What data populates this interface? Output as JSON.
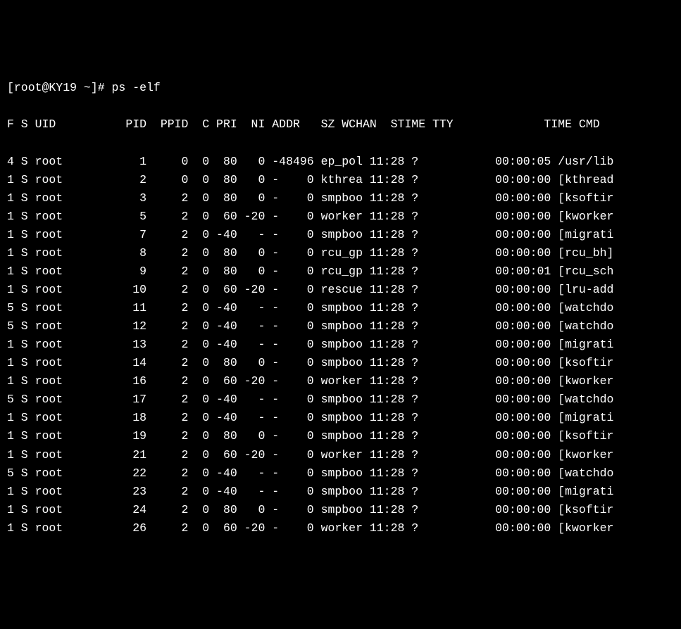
{
  "prompt": "[root@KY19 ~]# ps -elf",
  "header": {
    "F": "F",
    "S": "S",
    "UID": "UID",
    "PID": "PID",
    "PPID": "PPID",
    "C": "C",
    "PRI": "PRI",
    "NI": "NI",
    "ADDR": "ADDR",
    "SZ": "SZ",
    "WCHAN": "WCHAN",
    "STIME": "STIME",
    "TTY": "TTY",
    "TIME": "TIME",
    "CMD": "CMD"
  },
  "rows": [
    {
      "F": "4",
      "S": "S",
      "UID": "root",
      "PID": "1",
      "PPID": "0",
      "C": "0",
      "PRI": "80",
      "NI": "0",
      "ADDR": "-",
      "SZ": "48496",
      "WCHAN": "ep_pol",
      "STIME": "11:28",
      "TTY": "?",
      "TIME": "00:00:05",
      "CMD": "/usr/lib"
    },
    {
      "F": "1",
      "S": "S",
      "UID": "root",
      "PID": "2",
      "PPID": "0",
      "C": "0",
      "PRI": "80",
      "NI": "0",
      "ADDR": "-",
      "SZ": "0",
      "WCHAN": "kthrea",
      "STIME": "11:28",
      "TTY": "?",
      "TIME": "00:00:00",
      "CMD": "[kthread"
    },
    {
      "F": "1",
      "S": "S",
      "UID": "root",
      "PID": "3",
      "PPID": "2",
      "C": "0",
      "PRI": "80",
      "NI": "0",
      "ADDR": "-",
      "SZ": "0",
      "WCHAN": "smpboo",
      "STIME": "11:28",
      "TTY": "?",
      "TIME": "00:00:00",
      "CMD": "[ksoftir"
    },
    {
      "F": "1",
      "S": "S",
      "UID": "root",
      "PID": "5",
      "PPID": "2",
      "C": "0",
      "PRI": "60",
      "NI": "-20",
      "ADDR": "-",
      "SZ": "0",
      "WCHAN": "worker",
      "STIME": "11:28",
      "TTY": "?",
      "TIME": "00:00:00",
      "CMD": "[kworker"
    },
    {
      "F": "1",
      "S": "S",
      "UID": "root",
      "PID": "7",
      "PPID": "2",
      "C": "0",
      "PRI": "-40",
      "NI": "-",
      "ADDR": "-",
      "SZ": "0",
      "WCHAN": "smpboo",
      "STIME": "11:28",
      "TTY": "?",
      "TIME": "00:00:00",
      "CMD": "[migrati"
    },
    {
      "F": "1",
      "S": "S",
      "UID": "root",
      "PID": "8",
      "PPID": "2",
      "C": "0",
      "PRI": "80",
      "NI": "0",
      "ADDR": "-",
      "SZ": "0",
      "WCHAN": "rcu_gp",
      "STIME": "11:28",
      "TTY": "?",
      "TIME": "00:00:00",
      "CMD": "[rcu_bh]"
    },
    {
      "F": "1",
      "S": "S",
      "UID": "root",
      "PID": "9",
      "PPID": "2",
      "C": "0",
      "PRI": "80",
      "NI": "0",
      "ADDR": "-",
      "SZ": "0",
      "WCHAN": "rcu_gp",
      "STIME": "11:28",
      "TTY": "?",
      "TIME": "00:00:01",
      "CMD": "[rcu_sch"
    },
    {
      "F": "1",
      "S": "S",
      "UID": "root",
      "PID": "10",
      "PPID": "2",
      "C": "0",
      "PRI": "60",
      "NI": "-20",
      "ADDR": "-",
      "SZ": "0",
      "WCHAN": "rescue",
      "STIME": "11:28",
      "TTY": "?",
      "TIME": "00:00:00",
      "CMD": "[lru-add"
    },
    {
      "F": "5",
      "S": "S",
      "UID": "root",
      "PID": "11",
      "PPID": "2",
      "C": "0",
      "PRI": "-40",
      "NI": "-",
      "ADDR": "-",
      "SZ": "0",
      "WCHAN": "smpboo",
      "STIME": "11:28",
      "TTY": "?",
      "TIME": "00:00:00",
      "CMD": "[watchdo"
    },
    {
      "F": "5",
      "S": "S",
      "UID": "root",
      "PID": "12",
      "PPID": "2",
      "C": "0",
      "PRI": "-40",
      "NI": "-",
      "ADDR": "-",
      "SZ": "0",
      "WCHAN": "smpboo",
      "STIME": "11:28",
      "TTY": "?",
      "TIME": "00:00:00",
      "CMD": "[watchdo"
    },
    {
      "F": "1",
      "S": "S",
      "UID": "root",
      "PID": "13",
      "PPID": "2",
      "C": "0",
      "PRI": "-40",
      "NI": "-",
      "ADDR": "-",
      "SZ": "0",
      "WCHAN": "smpboo",
      "STIME": "11:28",
      "TTY": "?",
      "TIME": "00:00:00",
      "CMD": "[migrati"
    },
    {
      "F": "1",
      "S": "S",
      "UID": "root",
      "PID": "14",
      "PPID": "2",
      "C": "0",
      "PRI": "80",
      "NI": "0",
      "ADDR": "-",
      "SZ": "0",
      "WCHAN": "smpboo",
      "STIME": "11:28",
      "TTY": "?",
      "TIME": "00:00:00",
      "CMD": "[ksoftir"
    },
    {
      "F": "1",
      "S": "S",
      "UID": "root",
      "PID": "16",
      "PPID": "2",
      "C": "0",
      "PRI": "60",
      "NI": "-20",
      "ADDR": "-",
      "SZ": "0",
      "WCHAN": "worker",
      "STIME": "11:28",
      "TTY": "?",
      "TIME": "00:00:00",
      "CMD": "[kworker"
    },
    {
      "F": "5",
      "S": "S",
      "UID": "root",
      "PID": "17",
      "PPID": "2",
      "C": "0",
      "PRI": "-40",
      "NI": "-",
      "ADDR": "-",
      "SZ": "0",
      "WCHAN": "smpboo",
      "STIME": "11:28",
      "TTY": "?",
      "TIME": "00:00:00",
      "CMD": "[watchdo"
    },
    {
      "F": "1",
      "S": "S",
      "UID": "root",
      "PID": "18",
      "PPID": "2",
      "C": "0",
      "PRI": "-40",
      "NI": "-",
      "ADDR": "-",
      "SZ": "0",
      "WCHAN": "smpboo",
      "STIME": "11:28",
      "TTY": "?",
      "TIME": "00:00:00",
      "CMD": "[migrati"
    },
    {
      "F": "1",
      "S": "S",
      "UID": "root",
      "PID": "19",
      "PPID": "2",
      "C": "0",
      "PRI": "80",
      "NI": "0",
      "ADDR": "-",
      "SZ": "0",
      "WCHAN": "smpboo",
      "STIME": "11:28",
      "TTY": "?",
      "TIME": "00:00:00",
      "CMD": "[ksoftir"
    },
    {
      "F": "1",
      "S": "S",
      "UID": "root",
      "PID": "21",
      "PPID": "2",
      "C": "0",
      "PRI": "60",
      "NI": "-20",
      "ADDR": "-",
      "SZ": "0",
      "WCHAN": "worker",
      "STIME": "11:28",
      "TTY": "?",
      "TIME": "00:00:00",
      "CMD": "[kworker"
    },
    {
      "F": "5",
      "S": "S",
      "UID": "root",
      "PID": "22",
      "PPID": "2",
      "C": "0",
      "PRI": "-40",
      "NI": "-",
      "ADDR": "-",
      "SZ": "0",
      "WCHAN": "smpboo",
      "STIME": "11:28",
      "TTY": "?",
      "TIME": "00:00:00",
      "CMD": "[watchdo"
    },
    {
      "F": "1",
      "S": "S",
      "UID": "root",
      "PID": "23",
      "PPID": "2",
      "C": "0",
      "PRI": "-40",
      "NI": "-",
      "ADDR": "-",
      "SZ": "0",
      "WCHAN": "smpboo",
      "STIME": "11:28",
      "TTY": "?",
      "TIME": "00:00:00",
      "CMD": "[migrati"
    },
    {
      "F": "1",
      "S": "S",
      "UID": "root",
      "PID": "24",
      "PPID": "2",
      "C": "0",
      "PRI": "80",
      "NI": "0",
      "ADDR": "-",
      "SZ": "0",
      "WCHAN": "smpboo",
      "STIME": "11:28",
      "TTY": "?",
      "TIME": "00:00:00",
      "CMD": "[ksoftir"
    },
    {
      "F": "1",
      "S": "S",
      "UID": "root",
      "PID": "26",
      "PPID": "2",
      "C": "0",
      "PRI": "60",
      "NI": "-20",
      "ADDR": "-",
      "SZ": "0",
      "WCHAN": "worker",
      "STIME": "11:28",
      "TTY": "?",
      "TIME": "00:00:00",
      "CMD": "[kworker"
    }
  ]
}
